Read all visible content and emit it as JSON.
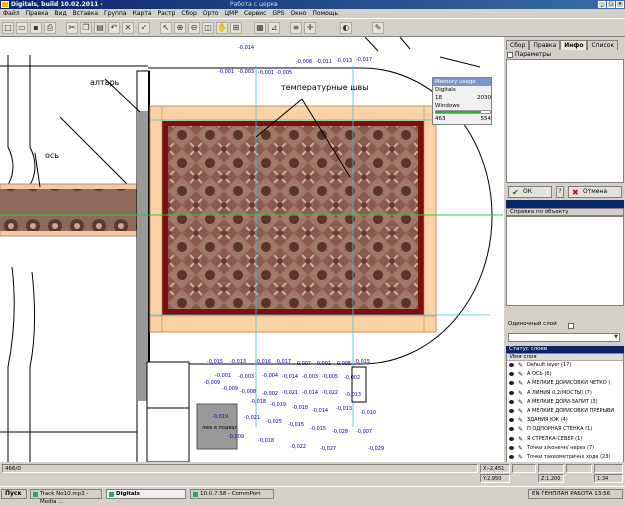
{
  "window": {
    "title": "Digitals, build 10.02.2011 -",
    "document": "Работа с церкв"
  },
  "menu": [
    "Файл",
    "Правка",
    "Вид",
    "Вставка",
    "Группа",
    "Карта",
    "Растр",
    "Сбор",
    "Орто",
    "ЦМР",
    "Сервис",
    "GPS",
    "Окно",
    "Помощь"
  ],
  "toolbar_icons": [
    "new-icon",
    "open-icon",
    "save-icon",
    "print-icon",
    "cut-icon",
    "copy-icon",
    "paste-icon",
    "undo-icon",
    "delete-icon",
    "check-icon",
    "select-icon",
    "zoom-in-icon",
    "zoom-out-icon",
    "zoom-window-icon",
    "pan-icon",
    "zoom-all-icon",
    "grid-icon",
    "measure-icon",
    "layers-icon",
    "snap-icon",
    "color-icon",
    "draw-icon"
  ],
  "memory": {
    "title": "Memory usage",
    "digitals_label": "Digitals",
    "digitals_used": "18",
    "digitals_total": "2030",
    "windows_label": "Windows",
    "windows_used": "463",
    "windows_total": "554",
    "windows_fraction": 0.84
  },
  "annotations": {
    "altar": "алтарь",
    "axis": "ось",
    "seams": "температурные швы",
    "hatch": "люк в подвал"
  },
  "canvas_labels": [
    "-0,014",
    "-0,001",
    "-0,003",
    "-0,001",
    "-0,005",
    "-0,008",
    "-0,011",
    "-0,013",
    "-0,017",
    "-0,015",
    "-0,013",
    "-0,016",
    "-0,017",
    "-0,007",
    "-0,001",
    "-0,005",
    "-0,015",
    "-0,001",
    "-0,003",
    "-0,004",
    "-0,014",
    "-0,003",
    "-0,005",
    "-0,002",
    "-0,009",
    "-0,009",
    "-0,008",
    "-0,002",
    "-0,021",
    "-0,014",
    "-0,022",
    "-0,013",
    "-0,018",
    "-0,019",
    "-0,018",
    "-0,014",
    "-0,013",
    "-0,010",
    "-0,019",
    "-0,021",
    "-0,025",
    "-0,015",
    "-0,015",
    "-0,028",
    "-0,007",
    "-0,029",
    "-0,009",
    "-0,018",
    "-0,022",
    "-0,027"
  ],
  "right_panel": {
    "tabs": [
      "Сбор",
      "Правка",
      "Инфо",
      "Список"
    ],
    "active_tab": "Инфо",
    "params_label": "Параметры",
    "ok_label": "ОК",
    "cancel_label": "Отмена",
    "help_header": "Справка по объекту",
    "single_layer_label": "Одиночный слой",
    "layer_header": "Статус слоев",
    "layer_col": "Имя слоя",
    "layers": [
      "Default layer (17)",
      "А    ОСЬ (6)",
      "А  МЕЛКИЕ ДОРИСОВКИ ЧЕТКО (",
      "А ЛИНИЯ 0,2(МОСТЫ) (7)",
      "А МЕЛКИЕ ДОРИ-ЗАЛИТ (3)",
      "А МЕЛКИЕ ДОРИСОВКИ ПРЕРЫВИ",
      "ЗДАНИЯ КЖ (4)",
      "П ОДПОРНАЯ   СТЕНКА (1)",
      "Я СТРЕЛКА-СЕВЕР (1)",
      "Точки з/конечн/ нерез (7)",
      "Точки тахеометричнх ходе (23(",
      "Текстовый блок (1)",
      "Изображения (149)"
    ]
  },
  "status": {
    "page": "466/0",
    "x": "X:-2,451",
    "y": "Y:2,950",
    "scale": "Z:1,200",
    "ratio": "1:34"
  },
  "taskbar": {
    "start": "Пуск",
    "tasks": [
      "Track No10.mp3 - Media ...",
      "Digitals",
      "10.0.7.58 - CommPort"
    ],
    "tray": "EN  ГЕНПЛАН РАБОТА   13:56"
  }
}
